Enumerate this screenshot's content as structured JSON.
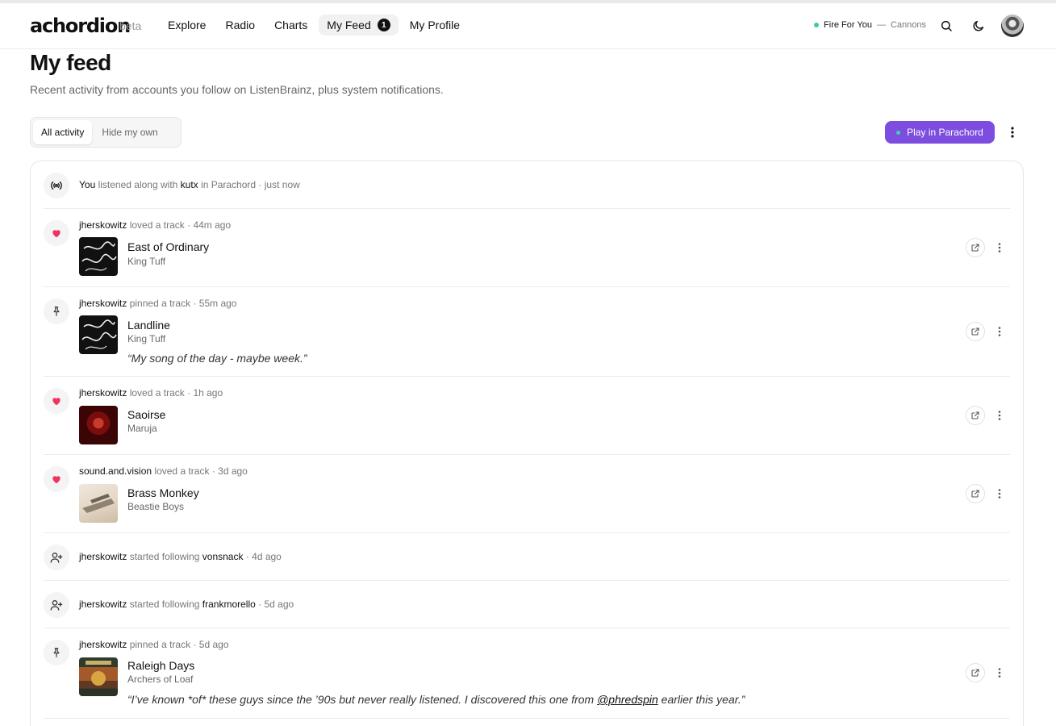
{
  "app": {
    "logo": "achordion",
    "beta": "beta"
  },
  "nav": [
    {
      "label": "Explore",
      "active": false
    },
    {
      "label": "Radio",
      "active": false
    },
    {
      "label": "Charts",
      "active": false
    },
    {
      "label": "My Feed",
      "active": true,
      "badge": "1"
    },
    {
      "label": "My Profile",
      "active": false
    }
  ],
  "now_playing": {
    "track": "Fire For You",
    "separator": "—",
    "artist": "Cannons"
  },
  "page": {
    "title": "My feed",
    "subtitle": "Recent activity from accounts you follow on ListenBrainz, plus system notifications."
  },
  "filters": {
    "all": "All activity",
    "hide_own": "Hide my own",
    "selected": "All activity"
  },
  "actions": {
    "play": "Play in Parachord"
  },
  "colors": {
    "accent": "#7c4ddf",
    "heart": "#f0335f",
    "live_dot": "#3ecf8e"
  },
  "feed": [
    {
      "kind": "listen",
      "icon": "broadcast-icon",
      "user": "You",
      "verb": "listened along with",
      "target": "kutx",
      "suffix": "in Parachord",
      "time": "just now"
    },
    {
      "kind": "track",
      "icon": "heart-icon",
      "user": "jherskowitz",
      "verb": "loved a track",
      "time": "44m ago",
      "title": "East of Ordinary",
      "artist": "King Tuff"
    },
    {
      "kind": "track",
      "icon": "pin-icon",
      "user": "jherskowitz",
      "verb": "pinned a track",
      "time": "55m ago",
      "title": "Landline",
      "artist": "King Tuff",
      "quote": "“My song of the day - maybe week.”"
    },
    {
      "kind": "track",
      "icon": "heart-icon",
      "user": "jherskowitz",
      "verb": "loved a track",
      "time": "1h ago",
      "title": "Saoirse",
      "artist": "Maruja"
    },
    {
      "kind": "track",
      "icon": "heart-icon",
      "user": "sound.and.vision",
      "verb": "loved a track",
      "time": "3d ago",
      "title": "Brass Monkey",
      "artist": "Beastie Boys"
    },
    {
      "kind": "follow",
      "icon": "user-plus-icon",
      "user": "jherskowitz",
      "verb": "started following",
      "target": "vonsnack",
      "time": "4d ago"
    },
    {
      "kind": "follow",
      "icon": "user-plus-icon",
      "user": "jherskowitz",
      "verb": "started following",
      "target": "frankmorello",
      "time": "5d ago"
    },
    {
      "kind": "track",
      "icon": "pin-icon",
      "user": "jherskowitz",
      "verb": "pinned a track",
      "time": "5d ago",
      "title": "Raleigh Days",
      "artist": "Archers of Loaf",
      "quote_pre": "“I’ve known *of* these guys since the ’90s but never really listened. I discovered this one from ",
      "quote_link": "@phredspin",
      "quote_post": " earlier this year.”"
    }
  ]
}
